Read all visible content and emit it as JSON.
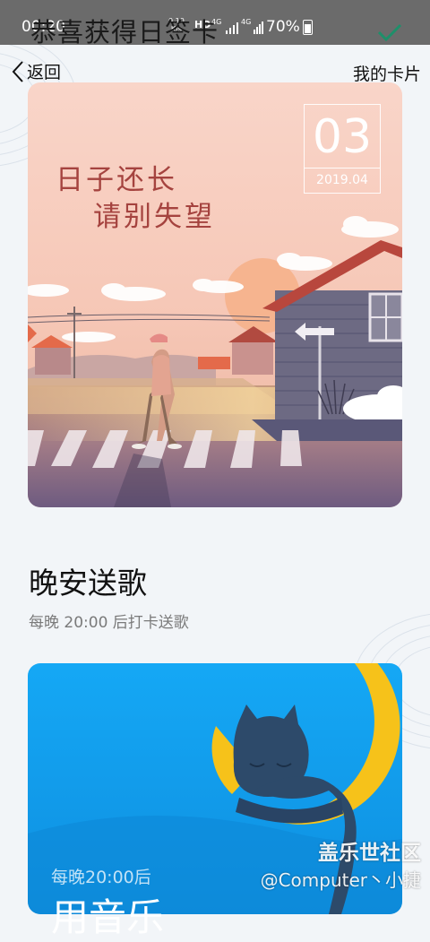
{
  "status_bar": {
    "time": "00:20",
    "net_speed_value": "0.10",
    "net_speed_unit": "K/s",
    "hd": "HD",
    "network_1": "4G",
    "network_2": "4G",
    "battery": "70%"
  },
  "toast": {
    "text": "恭喜获得日签卡"
  },
  "header": {
    "back_label": "返回",
    "right_link": "我的卡片"
  },
  "day_card": {
    "day": "03",
    "year_month": "2019.04",
    "poem_line1": "日子还长",
    "poem_line2": "请别失望"
  },
  "section": {
    "title": "晚安送歌",
    "subtitle": "每晚 20:00 后打卡送歌"
  },
  "night_card": {
    "subtitle": "每晚20:00后",
    "title": "用音乐"
  },
  "watermark": {
    "brand": "盖乐世社区",
    "author": "@Computer丶小捷"
  },
  "colors": {
    "accent_check": "#1e8f6a",
    "poem_red": "#a5433f",
    "night_blue": "#1aa7f0",
    "moon_yellow": "#f6c21a"
  }
}
